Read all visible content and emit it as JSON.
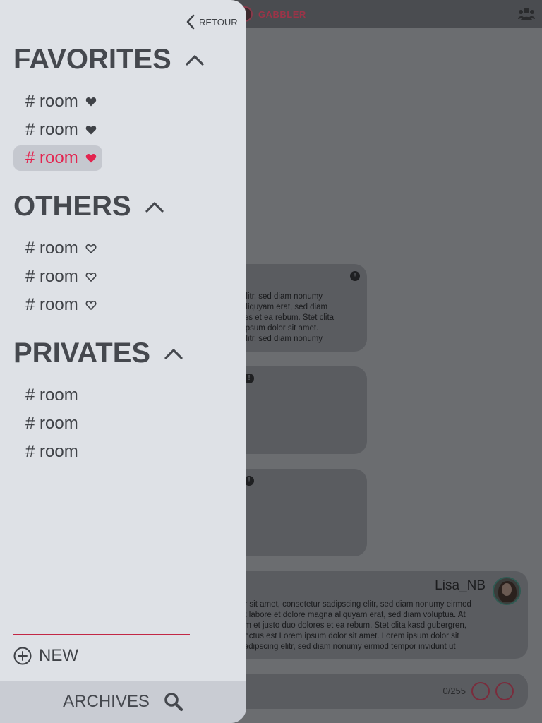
{
  "app": {
    "brand_name": "GABBLER",
    "accent_color": "#e3244f"
  },
  "chat": {
    "bubble1_text": "elitr, sed diam nonumy\naliquyam erat, sed diam\nres et ea rebum. Stet clita\n ipsum dolor sit amet.\nelitr, sed diam nonumy",
    "bubble4_author": "Lisa_NB",
    "bubble4_text": "or sit amet, consetetur sadipscing elitr, sed diam nonumy eirmod\nut labore et dolore magna aliquyam erat, sed diam voluptua. At\nam et justo duo dolores et ea rebum. Stet clita kasd gubergren,\nanctus est Lorem ipsum dolor sit amet. Lorem ipsum dolor sit\nsadipscing elitr, sed diam nonumy eirmod tempor invidunt ut",
    "char_counter": "0/255"
  },
  "drawer": {
    "back_label": "RETOUR",
    "sections": {
      "favorites": {
        "title": "FAVORITES",
        "rooms": [
          {
            "label": "# room",
            "heart": "filled"
          },
          {
            "label": "# room",
            "heart": "filled"
          },
          {
            "label": "# room",
            "heart": "filled",
            "active": true
          }
        ]
      },
      "others": {
        "title": "OTHERS",
        "rooms": [
          {
            "label": "# room",
            "heart": "outline"
          },
          {
            "label": "# room",
            "heart": "outline"
          },
          {
            "label": "# room",
            "heart": "outline"
          }
        ]
      },
      "privates": {
        "title": "PRIVATES",
        "rooms": [
          {
            "label": "# room"
          },
          {
            "label": "# room"
          },
          {
            "label": "# room"
          }
        ]
      }
    },
    "new_label": "NEW",
    "archives_label": "ARCHIVES"
  }
}
